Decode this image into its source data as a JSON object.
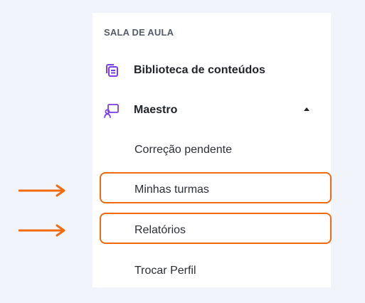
{
  "sidebar": {
    "section_title": "SALA DE AULA",
    "items": [
      {
        "label": "Biblioteca de conteúdos",
        "icon": "library-icon"
      },
      {
        "label": "Maestro",
        "icon": "teacher-board-icon",
        "expanded": true
      }
    ],
    "subitems": [
      {
        "label": "Correção pendente"
      },
      {
        "label": "Minhas turmas",
        "highlighted": true
      },
      {
        "label": "Relatórios",
        "highlighted": true
      }
    ],
    "footer_item": {
      "label": "Trocar Perfil"
    }
  },
  "colors": {
    "accent_icon": "#7b3fe4",
    "highlight": "#f26a0f",
    "background": "#f1f5fb"
  }
}
